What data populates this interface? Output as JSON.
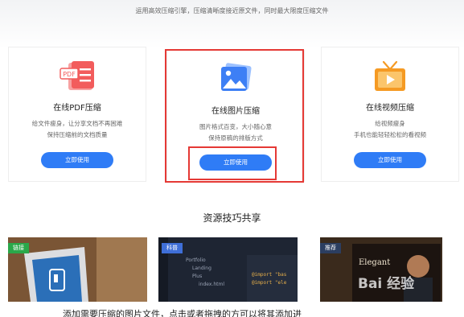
{
  "header": {
    "subtitle": "运用高效压缩引擎，压缩清晰度接近原文件，同时最大限度压缩文件"
  },
  "cards": [
    {
      "title": "在线PDF压缩",
      "desc_line1": "给文件瘦身，让分享文档不再困难",
      "desc_line2": "保持压缩前的文档质量",
      "button": "立即使用",
      "icon": "pdf-icon",
      "icon_badge": "PDF"
    },
    {
      "title": "在线图片压缩",
      "desc_line1": "图片格式百变，大小随心意",
      "desc_line2": "保持原稿的排版方式",
      "button": "立即使用",
      "icon": "image-icon"
    },
    {
      "title": "在线视频压缩",
      "desc_line1": "给视频瘦身",
      "desc_line2": "手机也能轻轻松松的看视频",
      "button": "立即使用",
      "icon": "tv-play-icon"
    }
  ],
  "section": {
    "title": "资源技巧共享"
  },
  "thumbnails": [
    {
      "tag": "链接"
    },
    {
      "tag": "科普",
      "tree_items": [
        "Portfolio",
        "Landing",
        "Plus",
        "index.html"
      ],
      "code_lines": [
        "@import \"bas",
        "@import \"ele"
      ]
    },
    {
      "tag": "推荐",
      "text": "Elegant"
    }
  ],
  "watermark": "Bai 经验",
  "footer": {
    "text": "添加需要压缩的图片文件，点击或者拖拽的方可以将其添加进"
  },
  "colors": {
    "accent": "#2f7cf6",
    "highlight": "#e53935",
    "pdf": "#f25c5c",
    "image": "#3d7ff5",
    "video": "#f59a23"
  }
}
